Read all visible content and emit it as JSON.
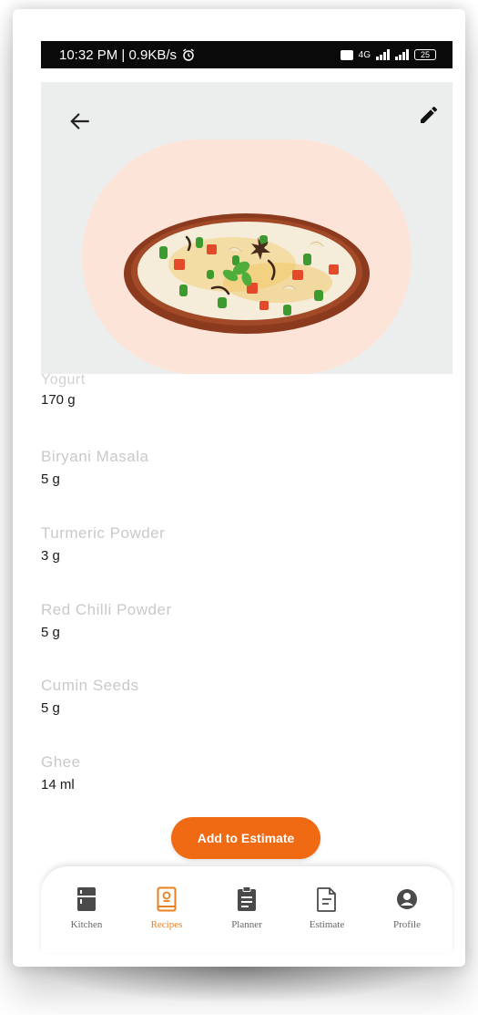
{
  "status_bar": {
    "time": "10:32 PM",
    "speed": "0.9KB/s",
    "network": "4G",
    "battery": "25"
  },
  "header": {
    "back_icon": "arrow-left-icon",
    "edit_icon": "pencil-icon"
  },
  "ingredients": [
    {
      "name": "Yogurt",
      "quantity": "170 g"
    },
    {
      "name": "Biryani Masala",
      "quantity": "5 g"
    },
    {
      "name": "Turmeric Powder",
      "quantity": "3 g"
    },
    {
      "name": "Red Chilli Powder",
      "quantity": "5 g"
    },
    {
      "name": "Cumin Seeds",
      "quantity": "5 g"
    },
    {
      "name": "Ghee",
      "quantity": "14 ml"
    }
  ],
  "actions": {
    "add_to_estimate": "Add to Estimate"
  },
  "bottom_nav": [
    {
      "label": "Kitchen",
      "icon": "fridge-icon",
      "active": false
    },
    {
      "label": "Recipes",
      "icon": "recipe-book-icon",
      "active": true
    },
    {
      "label": "Planner",
      "icon": "clipboard-icon",
      "active": false
    },
    {
      "label": "Estimate",
      "icon": "document-icon",
      "active": false
    },
    {
      "label": "Profile",
      "icon": "user-circle-icon",
      "active": false
    }
  ],
  "colors": {
    "accent": "#ef6a12",
    "active_nav": "#e8801e",
    "hero_bg": "#eceeed",
    "blob": "#fde4d9",
    "ingredient_name": "#c9c9c9",
    "nav_icon": "#4a4a4a"
  }
}
